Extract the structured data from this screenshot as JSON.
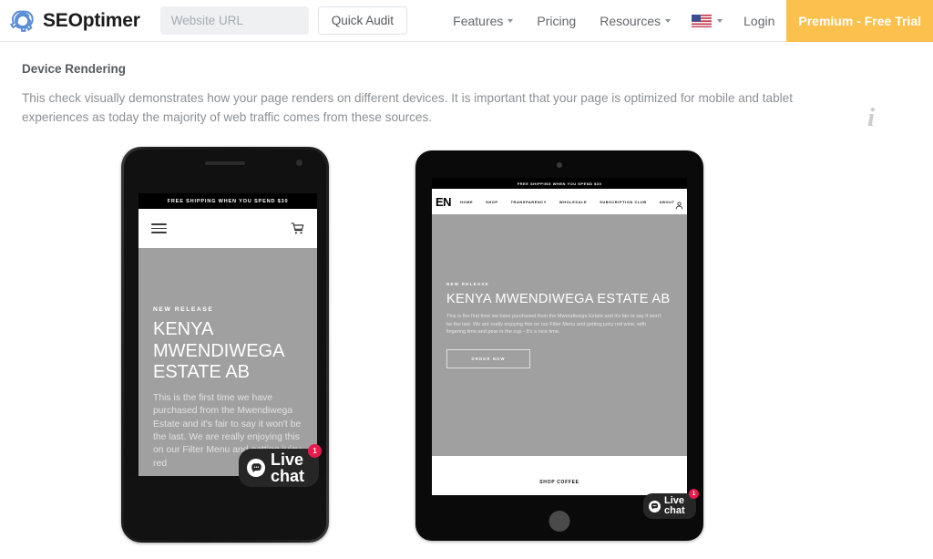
{
  "header": {
    "brand": "SEOptimer",
    "brand_icon": "seoptimer-gear-icon",
    "search": {
      "placeholder": "Website URL",
      "value": ""
    },
    "quick_audit_label": "Quick Audit",
    "nav": [
      {
        "label": "Features",
        "has_caret": true
      },
      {
        "label": "Pricing",
        "has_caret": false
      },
      {
        "label": "Resources",
        "has_caret": true
      }
    ],
    "language": {
      "icon": "us-flag-icon",
      "has_caret": true
    },
    "login_label": "Login",
    "premium_label": "Premium - Free Trial",
    "premium_color": "#fcc04c"
  },
  "section": {
    "title": "Device Rendering",
    "description": "This check visually demonstrates how your page renders on different devices. It is important that your page is optimized for mobile and tablet experiences as today the majority of web traffic comes from these sources.",
    "info_icon": "info-icon",
    "info_glyph": "i"
  },
  "phone_preview": {
    "shipping_banner": "FREE SHIPPING WHEN YOU SPEND $30",
    "menu_icon": "hamburger-menu-icon",
    "cart_icon": "shopping-cart-icon",
    "kicker": "NEW RELEASE",
    "heading": "KENYA MWENDIWEGA ESTATE AB",
    "paragraph": "This is the first time we have purchased from the Mwendiwega Estate and it's fair to say it won't be the last. We are really enjoying this on our Filter Menu and getting juicy red",
    "live_chat": {
      "label_line1": "Live",
      "label_line2": "chat",
      "badge": "1",
      "icon": "chat-bubble-icon",
      "badge_color": "#e8194b"
    }
  },
  "tablet_preview": {
    "shipping_banner": "FREE SHIPPING WHEN YOU SPEND $30",
    "logo": "EN",
    "nav": [
      "HOME",
      "SHOP",
      "TRANSPARENCY",
      "WHOLESALE",
      "SUBSCRIPTION CLUB",
      "ABOUT"
    ],
    "account_icon": "user-account-icon",
    "kicker": "NEW RELEASE",
    "heading": "KENYA MWENDIWEGA ESTATE AB",
    "paragraph": "This is the first time we have purchased from the Mwendiwega Estate and it's fair to say it won't be the last. We are really enjoying this on our Filter Menu and getting juicy red wine, with lingering lime and pear in the cup - It's a nice time.",
    "order_button": "ORDER NOW",
    "footer_text": "SHOP COFFEE",
    "live_chat": {
      "label_line1": "Live",
      "label_line2": "chat",
      "badge": "1",
      "icon": "chat-bubble-icon",
      "badge_color": "#e8194b"
    }
  }
}
